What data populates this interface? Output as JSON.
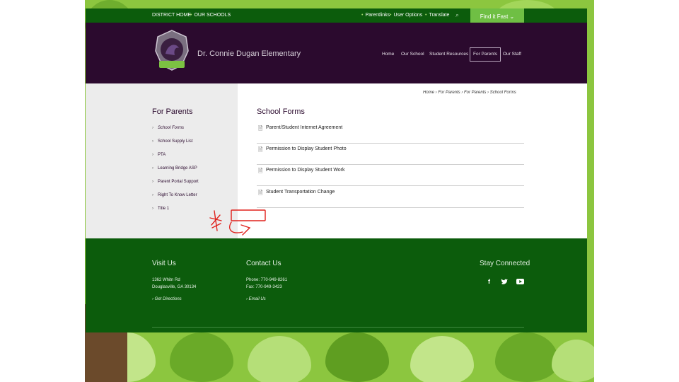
{
  "utility": {
    "district_home": "DISTRICT HOME",
    "our_schools": "OUR SCHOOLS",
    "parentlinks": "Parentlinks",
    "user_options": "User Options",
    "translate": "Translate",
    "find_it_fast": "Find it Fast"
  },
  "header": {
    "school_name": "Dr. Connie Dugan Elementary",
    "nav": [
      "Home",
      "Our School",
      "Student Resources",
      "For Parents",
      "Our Staff"
    ]
  },
  "breadcrumb": "Home  ›  For Parents  ›  For Parents  ›  School Forms",
  "sidebar": {
    "title": "For Parents",
    "items": [
      "School Forms",
      "School Supply List",
      "PTA",
      "Learning Bridge ASP",
      "Parent Portal Support",
      "Right To Know Letter",
      "Title 1"
    ]
  },
  "main": {
    "title": "School Forms",
    "forms": [
      "Parent/Student Internet Agreement",
      "Permission to Display Student Photo",
      "Permission to Display Student Work",
      "Student Transportation Change"
    ]
  },
  "footer": {
    "visit_title": "Visit Us",
    "address1": "1362 Whitn Rd",
    "address2": "Douglasville, GA 30134",
    "directions": "Get Directions",
    "contact_title": "Contact Us",
    "phone": "Phone: 770-949-8261",
    "fax": "Fax: 770-949-3423",
    "email": "Email Us",
    "stay_title": "Stay Connected"
  },
  "colors": {
    "green_dark": "#0c5c0c",
    "purple_dark": "#2b0a2e",
    "green_light": "#6fbf44",
    "annotation_red": "#e0201b"
  }
}
